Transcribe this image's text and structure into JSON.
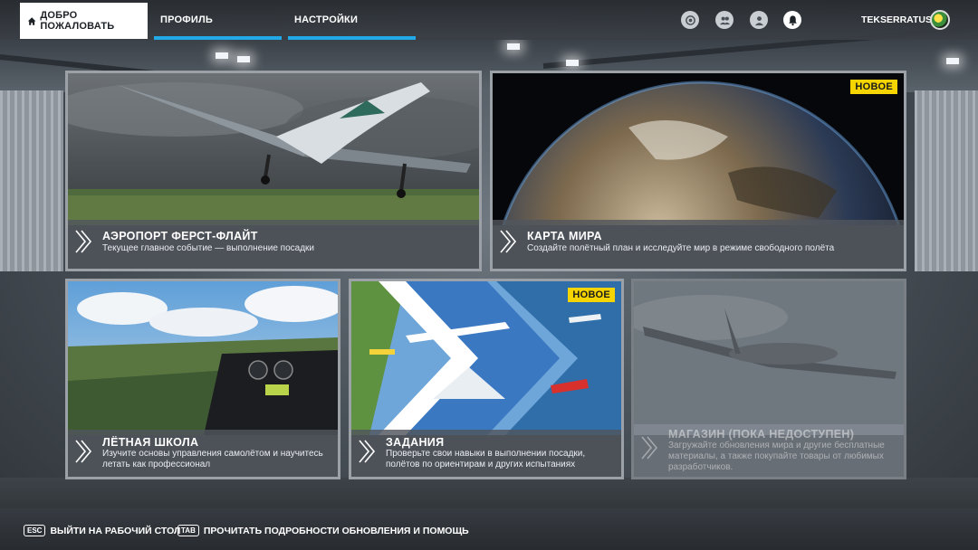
{
  "topbar": {
    "tabs": [
      {
        "label": "ДОБРО ПОЖАЛОВАТЬ",
        "active": true
      },
      {
        "label": "ПРОФИЛЬ",
        "active": false
      },
      {
        "label": "НАСТРОЙКИ",
        "active": false
      }
    ],
    "icons": [
      "activity-icon",
      "friends-icon",
      "user-icon",
      "notification-bell-icon"
    ],
    "username": "TEKSERRATUS",
    "accent_color": "#21a9e8"
  },
  "cards": [
    {
      "title": "АЭРОПОРТ ФЕРСТ-ФЛАЙТ",
      "description": "Текущее главное событие — выполнение посадки",
      "badge": ""
    },
    {
      "title": "КАРТА МИРА",
      "description": "Создайте полётный план и исследуйте мир в режиме свободного полёта",
      "badge": "НОВОЕ"
    },
    {
      "title": "ЛЁТНАЯ ШКОЛА",
      "description": "Изучите основы управления самолётом и научитесь летать как профессионал",
      "badge": ""
    },
    {
      "title": "ЗАДАНИЯ",
      "description": "Проверьте свои навыки в выполнении посадки, полётов по ориентирам и других испытаниях",
      "badge": "НОВОЕ"
    },
    {
      "title": "МАГАЗИН (ПОКА НЕДОСТУПЕН)",
      "description": "Загружайте обновления мира и другие бесплатные материалы, а также покупайте товары от любимых разработчиков.",
      "badge": "",
      "disabled": true
    }
  ],
  "footer": {
    "hints": [
      {
        "key": "ESC",
        "label": "ВЫЙТИ НА РАБОЧИЙ СТОЛ"
      },
      {
        "key": "TAB",
        "label": "ПРОЧИТАТЬ ПОДРОБНОСТИ ОБНОВЛЕНИЯ И ПОМОЩЬ"
      }
    ]
  },
  "badge_color": "#f5d400"
}
